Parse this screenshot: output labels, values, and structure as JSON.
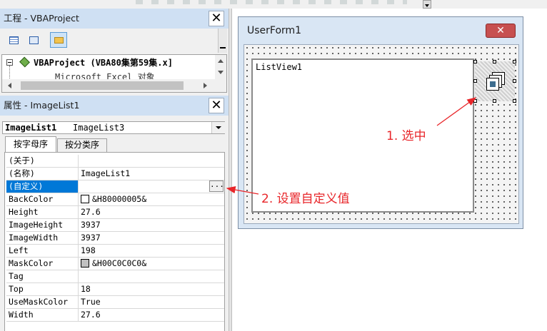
{
  "project_pane": {
    "title": "工程 - VBAProject",
    "tree": {
      "root_label": "VBAProject (VBA80集第59集.x]",
      "child_label": "Microsoft Excel 对象"
    }
  },
  "properties_pane": {
    "title": "属性 - ImageList1",
    "object_selector": {
      "name": "ImageList1",
      "type": "ImageList3"
    },
    "tabs": [
      {
        "label": "按字母序"
      },
      {
        "label": "按分类序"
      }
    ],
    "rows": [
      {
        "name": "(关于)",
        "value": ""
      },
      {
        "name": "(名称)",
        "value": "ImageList1"
      },
      {
        "name": "(自定义)",
        "value": "",
        "selected": true,
        "button": "..."
      },
      {
        "name": "BackColor",
        "value": "&H80000005&",
        "swatch": "#ffffff"
      },
      {
        "name": "Height",
        "value": "27.6"
      },
      {
        "name": "ImageHeight",
        "value": "3937"
      },
      {
        "name": "ImageWidth",
        "value": "3937"
      },
      {
        "name": "Left",
        "value": "198"
      },
      {
        "name": "MaskColor",
        "value": "&H00C0C0C0&",
        "swatch": "#c0c0c0"
      },
      {
        "name": "Tag",
        "value": ""
      },
      {
        "name": "Top",
        "value": "18"
      },
      {
        "name": "UseMaskColor",
        "value": "True"
      },
      {
        "name": "Width",
        "value": "27.6"
      }
    ]
  },
  "userform": {
    "title": "UserForm1",
    "listview_label": "ListView1"
  },
  "annotations": {
    "select_label": "1. 选中",
    "custom_label": "2. 设置自定义值",
    "color": "#e8262a"
  },
  "colors": {
    "title_bar": "#cfe0f3",
    "selection": "#0078d7",
    "close_red": "#c75050"
  }
}
